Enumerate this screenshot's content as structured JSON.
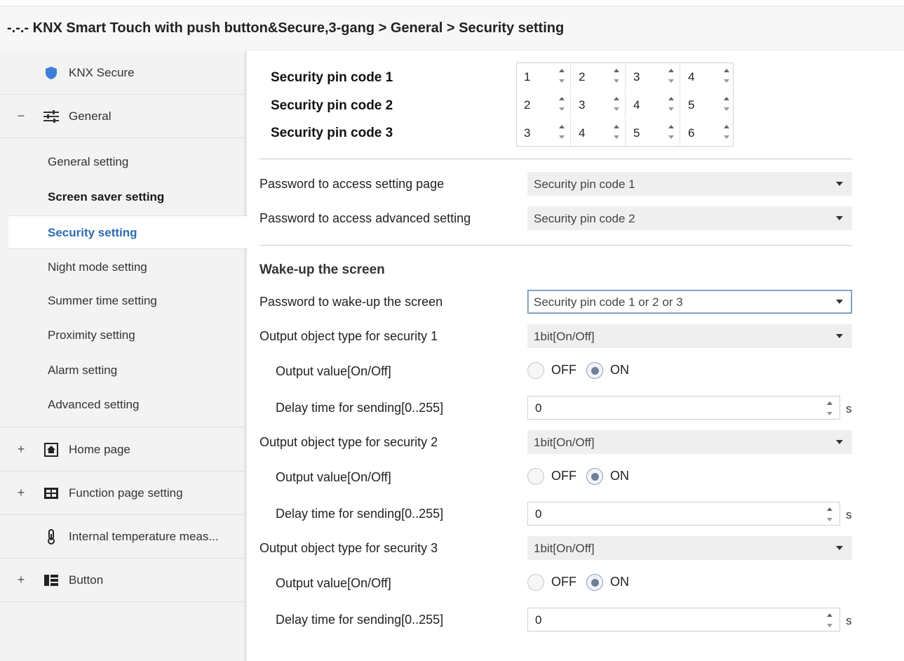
{
  "header": {
    "breadcrumb": "-.-.- KNX Smart Touch with push button&Secure,3-gang > General > Security setting"
  },
  "sidebar": {
    "top_items": [
      {
        "label": "KNX Secure",
        "icon": "shield-icon",
        "expander": ""
      },
      {
        "label": "General",
        "icon": "sliders-icon",
        "expander": "−"
      }
    ],
    "sub_items": [
      {
        "label": "General setting"
      },
      {
        "label": "Screen saver setting"
      },
      {
        "label": "Security setting"
      },
      {
        "label": "Night mode setting"
      },
      {
        "label": "Summer time setting"
      },
      {
        "label": "Proximity setting"
      },
      {
        "label": "Alarm setting"
      },
      {
        "label": "Advanced setting"
      }
    ],
    "bottom_items": [
      {
        "label": "Home page",
        "icon": "home-icon",
        "expander": "+"
      },
      {
        "label": "Function page setting",
        "icon": "grid-icon",
        "expander": "+"
      },
      {
        "label": "Internal temperature meas...",
        "icon": "thermometer-icon",
        "expander": ""
      },
      {
        "label": "Button",
        "icon": "button-icon",
        "expander": "+"
      }
    ]
  },
  "pins": {
    "rows": [
      {
        "label": "Security pin code 1",
        "digits": [
          "1",
          "2",
          "3",
          "4"
        ]
      },
      {
        "label": "Security pin code 2",
        "digits": [
          "2",
          "3",
          "4",
          "5"
        ]
      },
      {
        "label": "Security pin code 3",
        "digits": [
          "3",
          "4",
          "5",
          "6"
        ]
      }
    ]
  },
  "access": {
    "setting_page_label": "Password to access setting page",
    "setting_page_value": "Security pin code 1",
    "advanced_label": "Password to access advanced setting",
    "advanced_value": "Security pin code 2"
  },
  "wake": {
    "section_title": "Wake-up the screen",
    "password_label": "Password to wake-up the screen",
    "password_value": "Security pin code 1 or 2 or 3"
  },
  "security_outputs": [
    {
      "type_label": "Output object type for security 1",
      "type_value": "1bit[On/Off]",
      "value_label": "Output value[On/Off]",
      "off_label": "OFF",
      "on_label": "ON",
      "selected": "ON",
      "delay_label": "Delay time for sending[0..255]",
      "delay_value": "0",
      "delay_unit": "s"
    },
    {
      "type_label": "Output object type for security 2",
      "type_value": "1bit[On/Off]",
      "value_label": "Output value[On/Off]",
      "off_label": "OFF",
      "on_label": "ON",
      "selected": "ON",
      "delay_label": "Delay time for sending[0..255]",
      "delay_value": "0",
      "delay_unit": "s"
    },
    {
      "type_label": "Output object type for security 3",
      "type_value": "1bit[On/Off]",
      "value_label": "Output value[On/Off]",
      "off_label": "OFF",
      "on_label": "ON",
      "selected": "ON",
      "delay_label": "Delay time for sending[0..255]",
      "delay_value": "0",
      "delay_unit": "s"
    }
  ],
  "colors": {
    "active_nav": "#2b6cb0",
    "focus_border": "#6b8fb5",
    "shield": "#3d7fd6"
  }
}
